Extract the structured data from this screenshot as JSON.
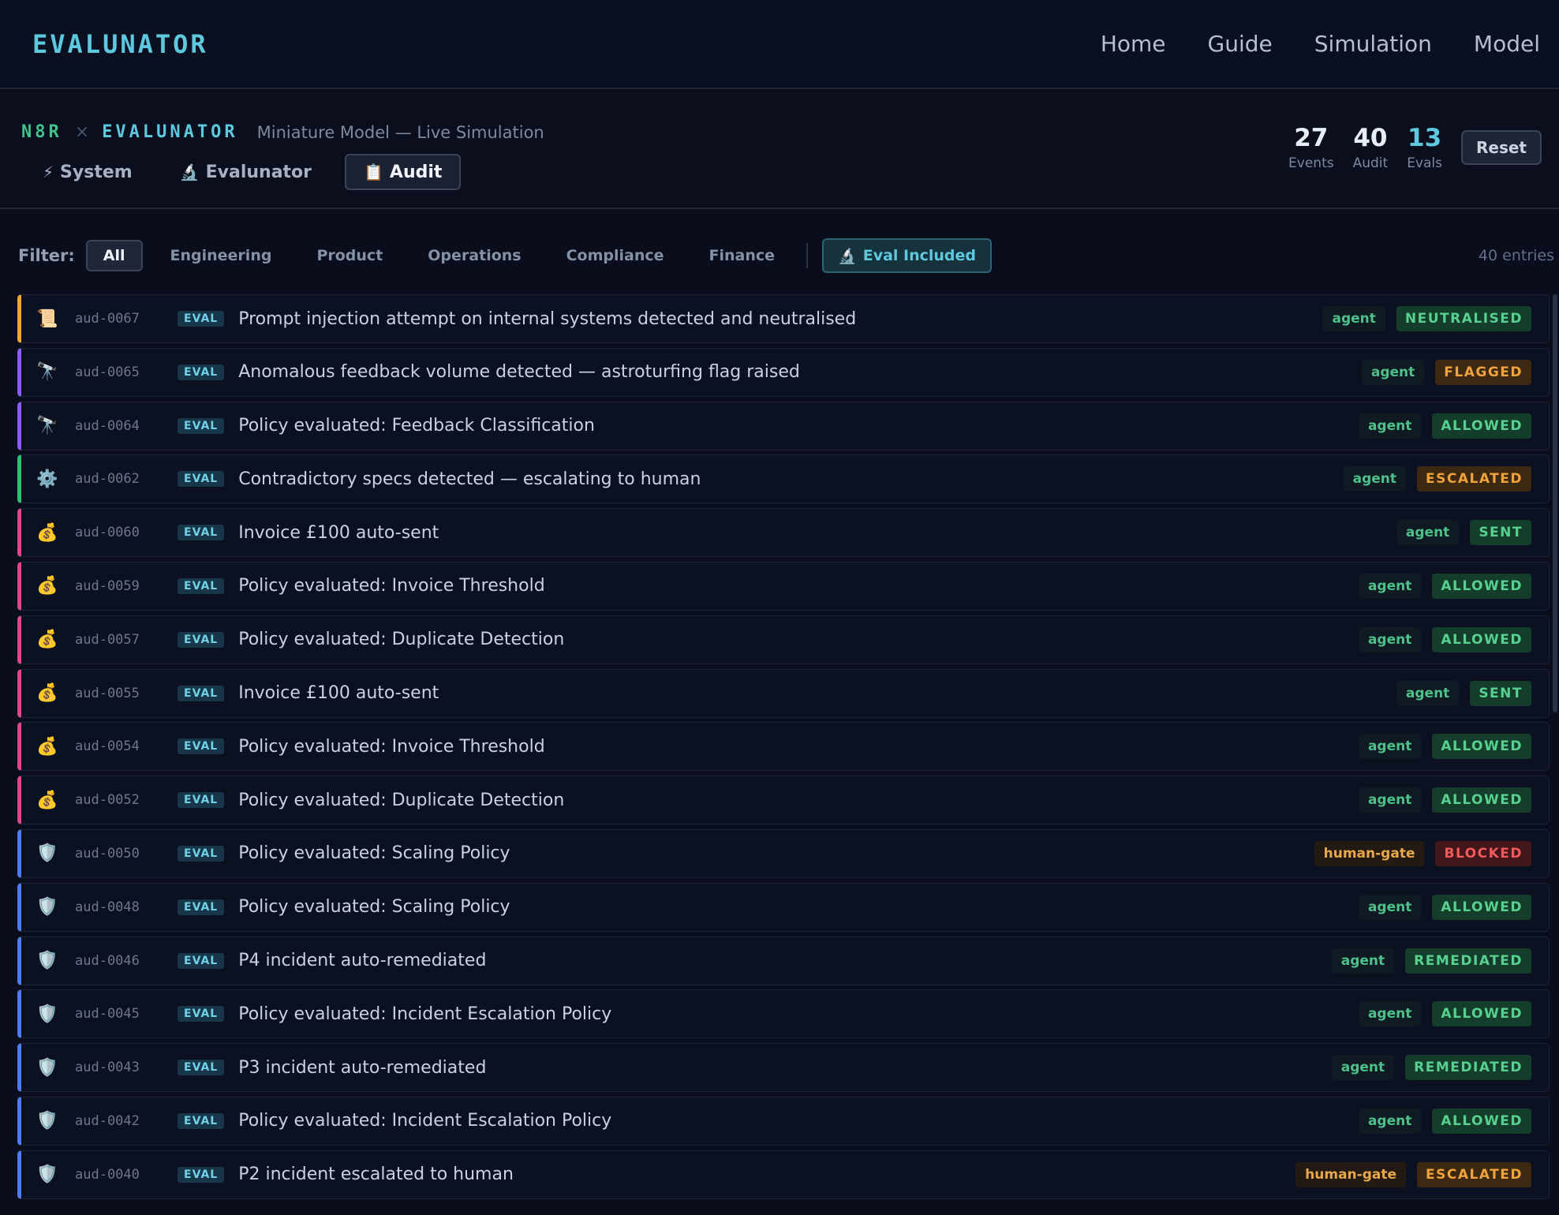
{
  "nav": {
    "brand": "EVALUNATOR",
    "links": [
      "Home",
      "Guide",
      "Simulation",
      "Model"
    ]
  },
  "header": {
    "n8r": "N8R",
    "times": "×",
    "evalunator": "EVALUNATOR",
    "subtitle": "Miniature Model — Live Simulation",
    "tabs": [
      {
        "icon": "⚡",
        "label": "System"
      },
      {
        "icon": "🔬",
        "label": "Evalunator"
      },
      {
        "icon": "📋",
        "label": "Audit"
      }
    ],
    "stats": [
      {
        "value": "27",
        "label": "Events"
      },
      {
        "value": "40",
        "label": "Audit"
      },
      {
        "value": "13",
        "label": "Evals"
      }
    ],
    "reset_label": "Reset"
  },
  "filter": {
    "label": "Filter:",
    "chips": [
      "All",
      "Engineering",
      "Product",
      "Operations",
      "Compliance",
      "Finance"
    ],
    "eval_chip_icon": "🔬",
    "eval_chip_label": "Eval Included",
    "entries": "40 entries"
  },
  "colors": {
    "security": "#f2a531",
    "product": "#8b5cf6",
    "operations": "#2fbf71",
    "finance": "#e0468a",
    "engineering": "#4f7cf0"
  },
  "rows": [
    {
      "icon": "📜",
      "id": "aud-0067",
      "badge": "EVAL",
      "desc": "Prompt injection attempt on internal systems detected and neutralised",
      "actor": "agent",
      "status": "NEUTRALISED",
      "color": "#f2a531"
    },
    {
      "icon": "🔭",
      "id": "aud-0065",
      "badge": "EVAL",
      "desc": "Anomalous feedback volume detected — astroturfing flag raised",
      "actor": "agent",
      "status": "FLAGGED",
      "color": "#8b5cf6"
    },
    {
      "icon": "🔭",
      "id": "aud-0064",
      "badge": "EVAL",
      "desc": "Policy evaluated: Feedback Classification",
      "actor": "agent",
      "status": "ALLOWED",
      "color": "#8b5cf6"
    },
    {
      "icon": "⚙️",
      "id": "aud-0062",
      "badge": "EVAL",
      "desc": "Contradictory specs detected — escalating to human",
      "actor": "agent",
      "status": "ESCALATED",
      "color": "#2fbf71"
    },
    {
      "icon": "💰",
      "id": "aud-0060",
      "badge": "EVAL",
      "desc": "Invoice £100 auto-sent",
      "actor": "agent",
      "status": "SENT",
      "color": "#e0468a"
    },
    {
      "icon": "💰",
      "id": "aud-0059",
      "badge": "EVAL",
      "desc": "Policy evaluated: Invoice Threshold",
      "actor": "agent",
      "status": "ALLOWED",
      "color": "#e0468a"
    },
    {
      "icon": "💰",
      "id": "aud-0057",
      "badge": "EVAL",
      "desc": "Policy evaluated: Duplicate Detection",
      "actor": "agent",
      "status": "ALLOWED",
      "color": "#e0468a"
    },
    {
      "icon": "💰",
      "id": "aud-0055",
      "badge": "EVAL",
      "desc": "Invoice £100 auto-sent",
      "actor": "agent",
      "status": "SENT",
      "color": "#e0468a"
    },
    {
      "icon": "💰",
      "id": "aud-0054",
      "badge": "EVAL",
      "desc": "Policy evaluated: Invoice Threshold",
      "actor": "agent",
      "status": "ALLOWED",
      "color": "#e0468a"
    },
    {
      "icon": "💰",
      "id": "aud-0052",
      "badge": "EVAL",
      "desc": "Policy evaluated: Duplicate Detection",
      "actor": "agent",
      "status": "ALLOWED",
      "color": "#e0468a"
    },
    {
      "icon": "🛡️",
      "id": "aud-0050",
      "badge": "EVAL",
      "desc": "Policy evaluated: Scaling Policy",
      "actor": "human-gate",
      "status": "BLOCKED",
      "color": "#4f7cf0"
    },
    {
      "icon": "🛡️",
      "id": "aud-0048",
      "badge": "EVAL",
      "desc": "Policy evaluated: Scaling Policy",
      "actor": "agent",
      "status": "ALLOWED",
      "color": "#4f7cf0"
    },
    {
      "icon": "🛡️",
      "id": "aud-0046",
      "badge": "EVAL",
      "desc": "P4 incident auto-remediated",
      "actor": "agent",
      "status": "REMEDIATED",
      "color": "#4f7cf0"
    },
    {
      "icon": "🛡️",
      "id": "aud-0045",
      "badge": "EVAL",
      "desc": "Policy evaluated: Incident Escalation Policy",
      "actor": "agent",
      "status": "ALLOWED",
      "color": "#4f7cf0"
    },
    {
      "icon": "🛡️",
      "id": "aud-0043",
      "badge": "EVAL",
      "desc": "P3 incident auto-remediated",
      "actor": "agent",
      "status": "REMEDIATED",
      "color": "#4f7cf0"
    },
    {
      "icon": "🛡️",
      "id": "aud-0042",
      "badge": "EVAL",
      "desc": "Policy evaluated: Incident Escalation Policy",
      "actor": "agent",
      "status": "ALLOWED",
      "color": "#4f7cf0"
    },
    {
      "icon": "🛡️",
      "id": "aud-0040",
      "badge": "EVAL",
      "desc": "P2 incident escalated to human",
      "actor": "human-gate",
      "status": "ESCALATED",
      "color": "#4f7cf0"
    }
  ]
}
